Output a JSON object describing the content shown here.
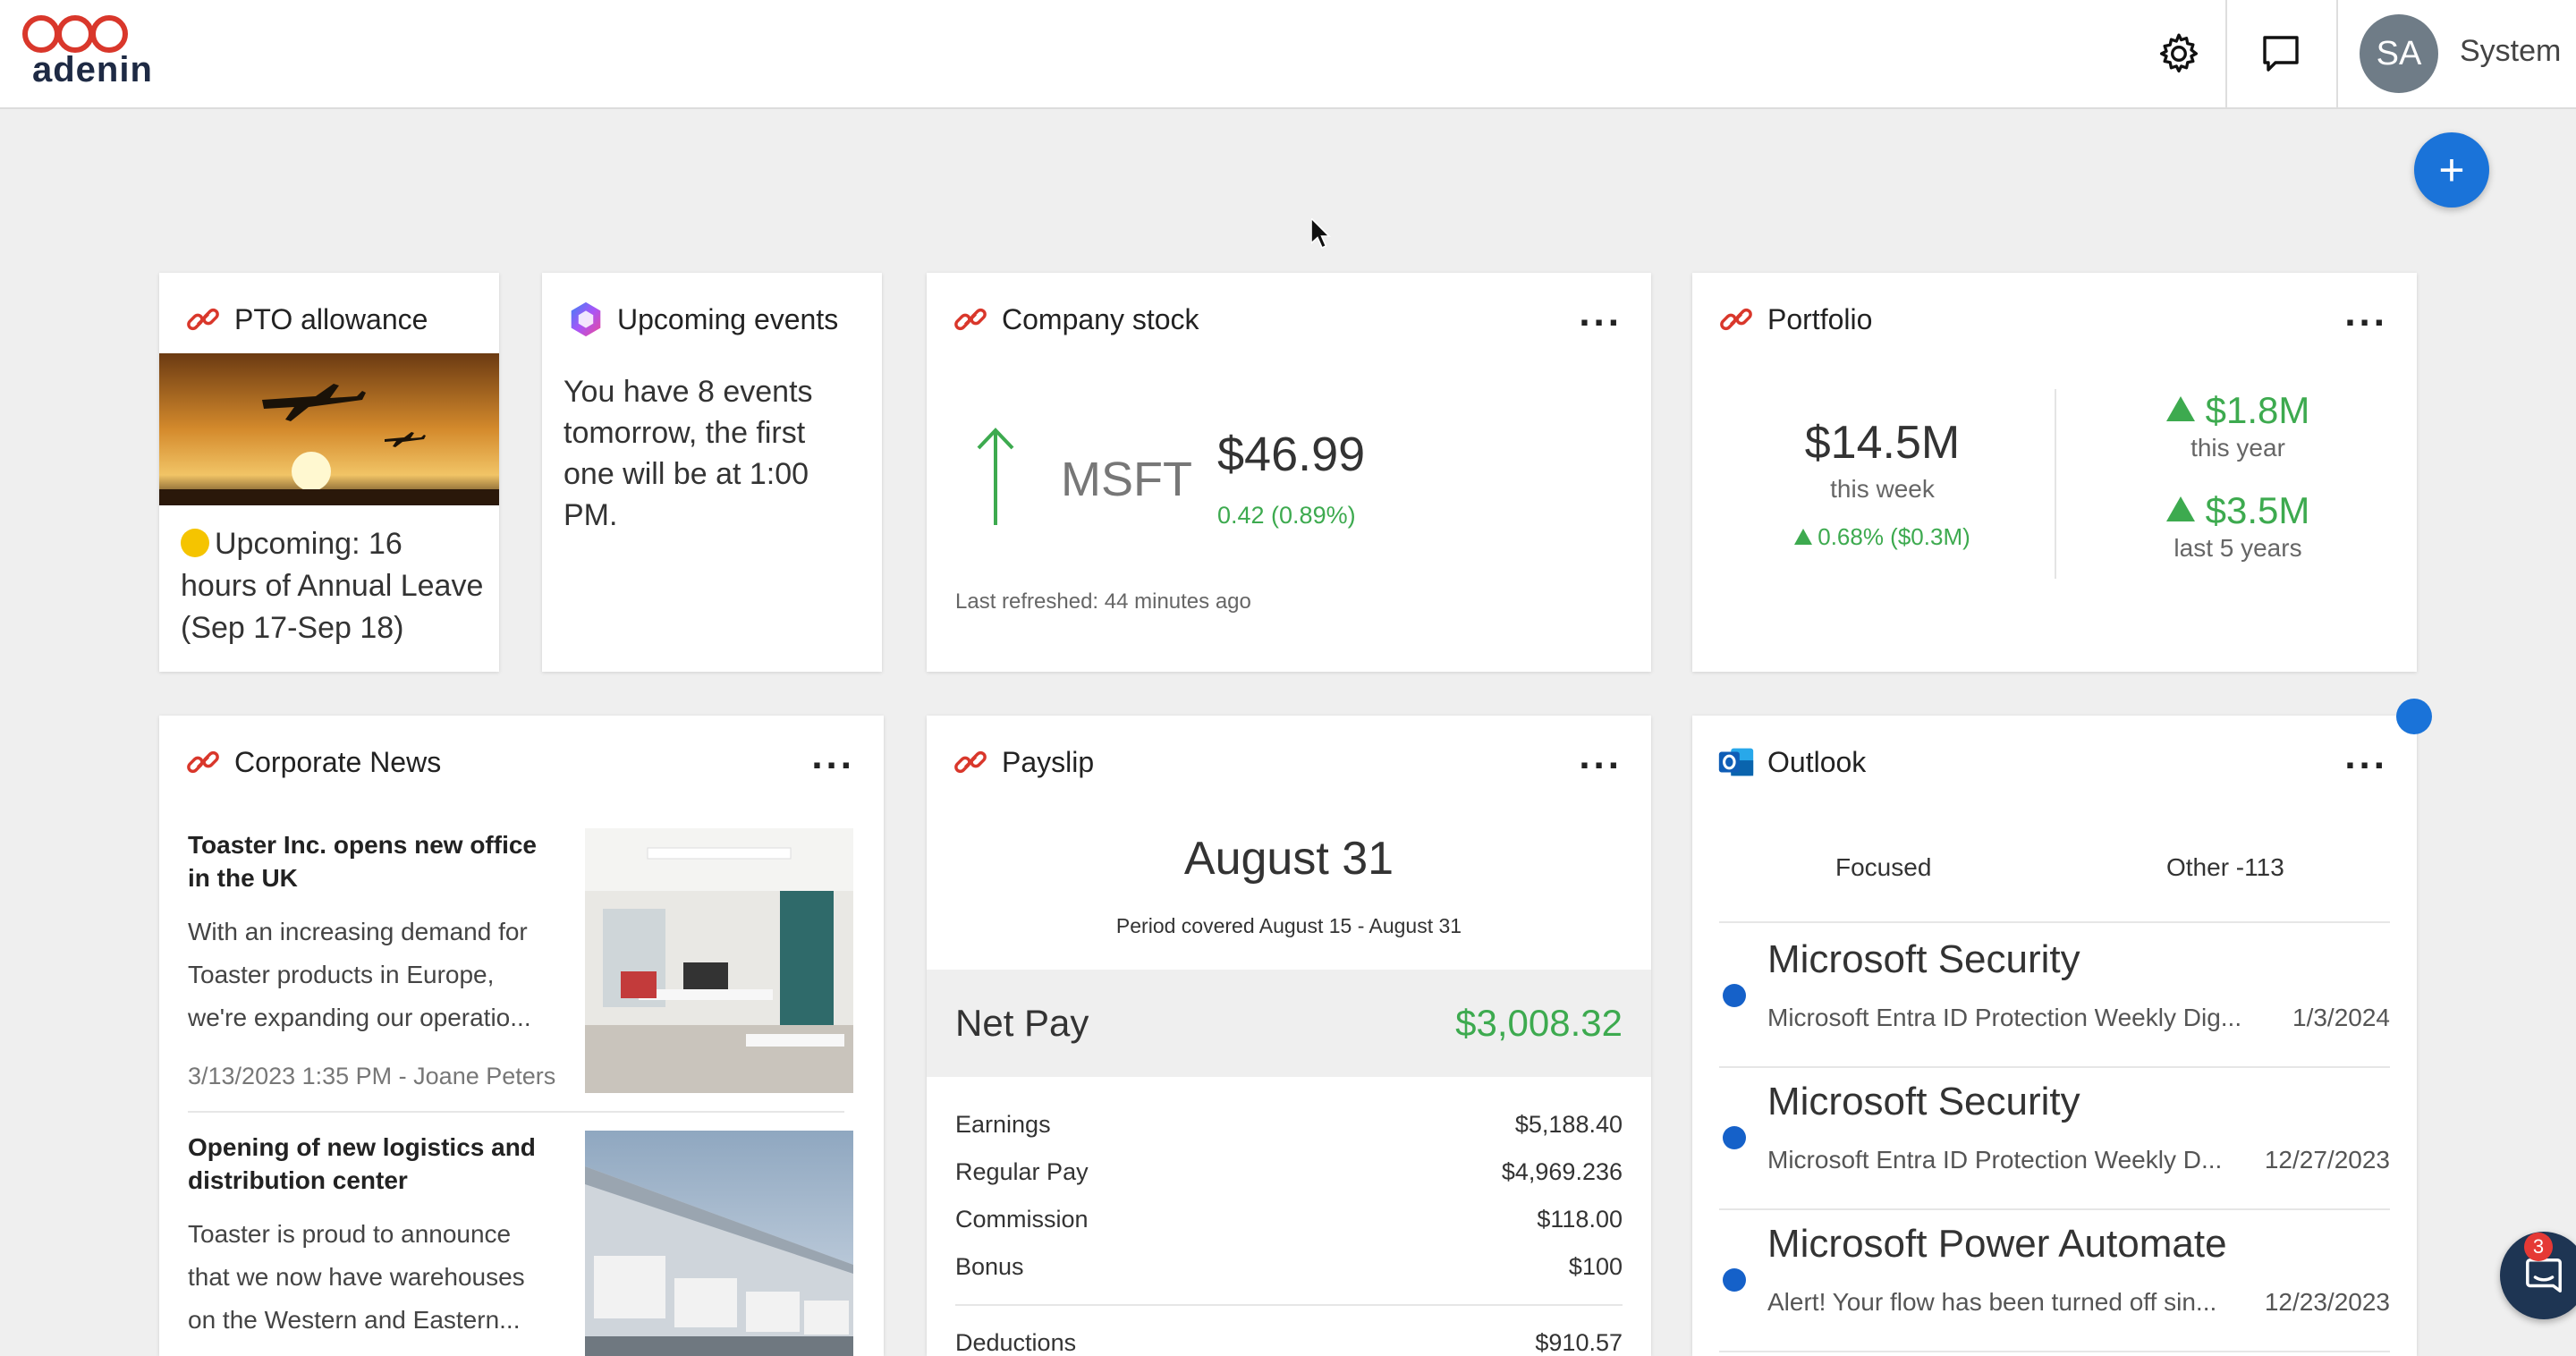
{
  "app": {
    "logo_text": "adenin",
    "user_initials": "SA",
    "user_name": "System"
  },
  "colors": {
    "accent": "#1a73d9",
    "positive": "#3daa4f",
    "brand_red": "#d9372b",
    "logo_dark": "#1e2a44"
  },
  "pto": {
    "title": "PTO allowance",
    "text": "Upcoming: 16 hours of Annual Leave (Sep 17-Sep 18)"
  },
  "events": {
    "title": "Upcoming events",
    "text": "You have 8 events tomorrow, the first one will be at 1:00 PM."
  },
  "stock": {
    "title": "Company stock",
    "symbol": "MSFT",
    "price": "$46.99",
    "change": "0.42 (0.89%)",
    "refreshed": "Last refreshed: 44 minutes ago"
  },
  "portfolio": {
    "title": "Portfolio",
    "value": "$14.5M",
    "value_label": "this week",
    "change": "0.68% ($0.3M)",
    "year_value": "$1.8M",
    "year_label": "this year",
    "five_year_value": "$3.5M",
    "five_year_label": "last 5 years"
  },
  "news": {
    "title": "Corporate News",
    "items": [
      {
        "title": "Toaster Inc. opens new office in the UK",
        "body": "With an increasing demand for Toaster products in Europe, we're expanding our operatio...",
        "meta": "3/13/2023 1:35 PM - Joane Peters"
      },
      {
        "title": "Opening of new logistics and distribution center",
        "body": "Toaster is proud to announce that we now have warehouses on the Western and Eastern..."
      }
    ]
  },
  "payslip": {
    "title": "Payslip",
    "date": "August 31",
    "period": "Period covered August 15 - August 31",
    "net_label": "Net Pay",
    "net_value": "$3,008.32",
    "rows": [
      {
        "label": "Earnings",
        "value": "$5,188.40"
      },
      {
        "label": "Regular Pay",
        "value": "$4,969.236"
      },
      {
        "label": "Commission",
        "value": "$118.00"
      },
      {
        "label": "Bonus",
        "value": "$100"
      },
      {
        "label": "Deductions",
        "value": "$910.57"
      }
    ]
  },
  "outlook": {
    "title": "Outlook",
    "tab_focused": "Focused",
    "tab_other": "Other -113",
    "emails": [
      {
        "from": "Microsoft Security",
        "subject": "Microsoft Entra ID Protection Weekly Dig...",
        "date": "1/3/2024"
      },
      {
        "from": "Microsoft Security",
        "subject": "Microsoft Entra ID Protection Weekly D...",
        "date": "12/27/2023"
      },
      {
        "from": "Microsoft Power Automate",
        "subject": "Alert! Your flow has been turned off sin...",
        "date": "12/23/2023"
      }
    ]
  },
  "chat": {
    "badge": "3"
  },
  "icons": [
    "gear-icon",
    "chat-icon",
    "plus-icon",
    "link-icon",
    "copilot-icon",
    "outlook-icon",
    "up-arrow-icon",
    "more-icon"
  ]
}
